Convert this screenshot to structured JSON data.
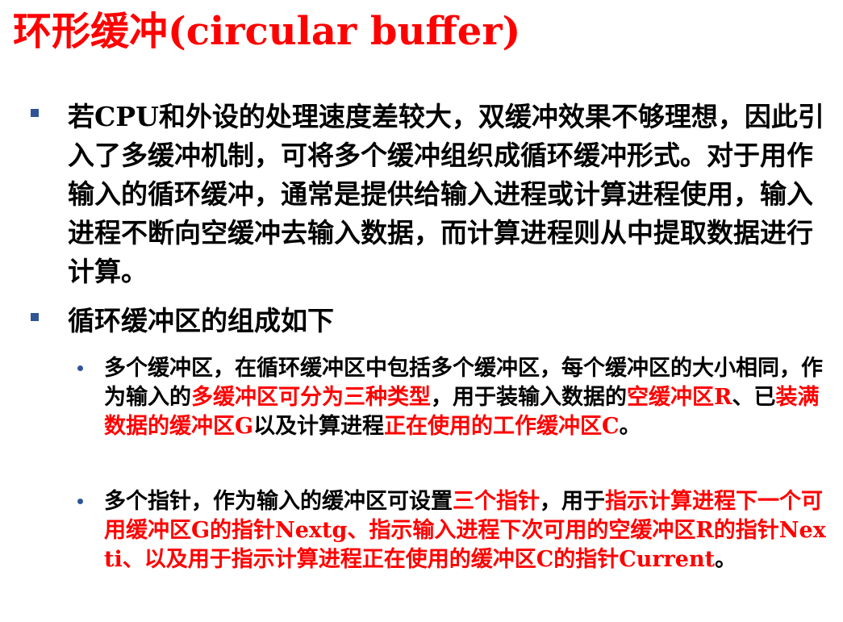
{
  "title": "环形缓冲(circular buffer)",
  "colors": {
    "title": "#ff0000",
    "highlight": "#ff0000",
    "text": "#000000",
    "bullet": "#2f5597"
  },
  "bullets": [
    {
      "segments": [
        {
          "text": "若CPU和外设的处理速度差较大，双缓冲效果不够理想，因此引入了多缓冲机制，可将多个缓冲组织成循环缓冲形式。对于用作输入的循环缓冲，通常是提供给输入进程或计算进程使用，输入进程不断向空缓冲去输入数据，而计算进程则从中提取数据进行计算。",
          "color": "black"
        }
      ]
    },
    {
      "segments": [
        {
          "text": "循环缓冲区的组成如下",
          "color": "black"
        }
      ]
    }
  ],
  "sub_bullets": [
    {
      "segments": [
        {
          "text": "多个缓冲区，在循环缓冲区中包括多个缓冲区，每个缓冲区的大小相同，作为输入的",
          "color": "black"
        },
        {
          "text": "多缓冲区可分为三种类型",
          "color": "red"
        },
        {
          "text": "，用于装输入数据的",
          "color": "black"
        },
        {
          "text": "空缓冲区R",
          "color": "red"
        },
        {
          "text": "、已",
          "color": "black"
        },
        {
          "text": "装满数据的缓冲区G",
          "color": "red"
        },
        {
          "text": "以及计算进程",
          "color": "black"
        },
        {
          "text": "正在使用的工作缓冲区C",
          "color": "red"
        },
        {
          "text": "。",
          "color": "black"
        }
      ]
    },
    {
      "segments": [
        {
          "text": "多个指针，作为输入的缓冲区可设置",
          "color": "black"
        },
        {
          "text": "三个指针",
          "color": "red"
        },
        {
          "text": "，用于",
          "color": "black"
        },
        {
          "text": "指示计算进程下一个可用缓冲区G的指针Nextg、指示输入进程下次可用的空缓冲区R的指针Nexti、以及用于指示计算进程正在使用的缓冲区C的指针Current",
          "color": "red"
        },
        {
          "text": "。",
          "color": "black"
        }
      ]
    }
  ]
}
